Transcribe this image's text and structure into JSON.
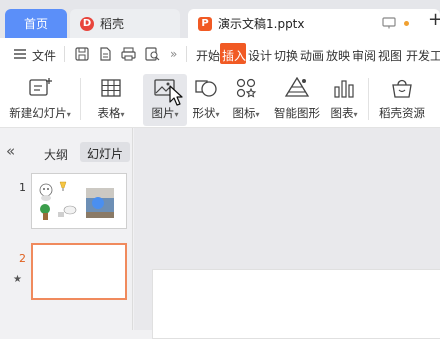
{
  "tabs": {
    "home": "首页",
    "daoke": "稻壳",
    "doc": "演示文稿1.pptx",
    "add": "+"
  },
  "menu": {
    "file": "文件",
    "more": "»",
    "items": [
      "开始",
      "插入",
      "设计",
      "切换",
      "动画",
      "放映",
      "审阅",
      "视图",
      "开发工"
    ],
    "active_index": 1
  },
  "ribbon": {
    "new_slide": "新建幻灯片",
    "table": "表格",
    "picture": "图片",
    "shape": "形状",
    "icon": "图标",
    "smartart": "智能图形",
    "chart": "图表",
    "resource": "稻壳资源",
    "dropdown": "▾"
  },
  "panel": {
    "collapse": "«",
    "outline": "大纲",
    "slides": "幻灯片",
    "slide1_num": "1",
    "slide2_num": "2",
    "star": "★"
  },
  "colors": {
    "accent": "#f15a24",
    "home_tab": "#5b8ff9",
    "active_slide_border": "#f08a5d"
  }
}
